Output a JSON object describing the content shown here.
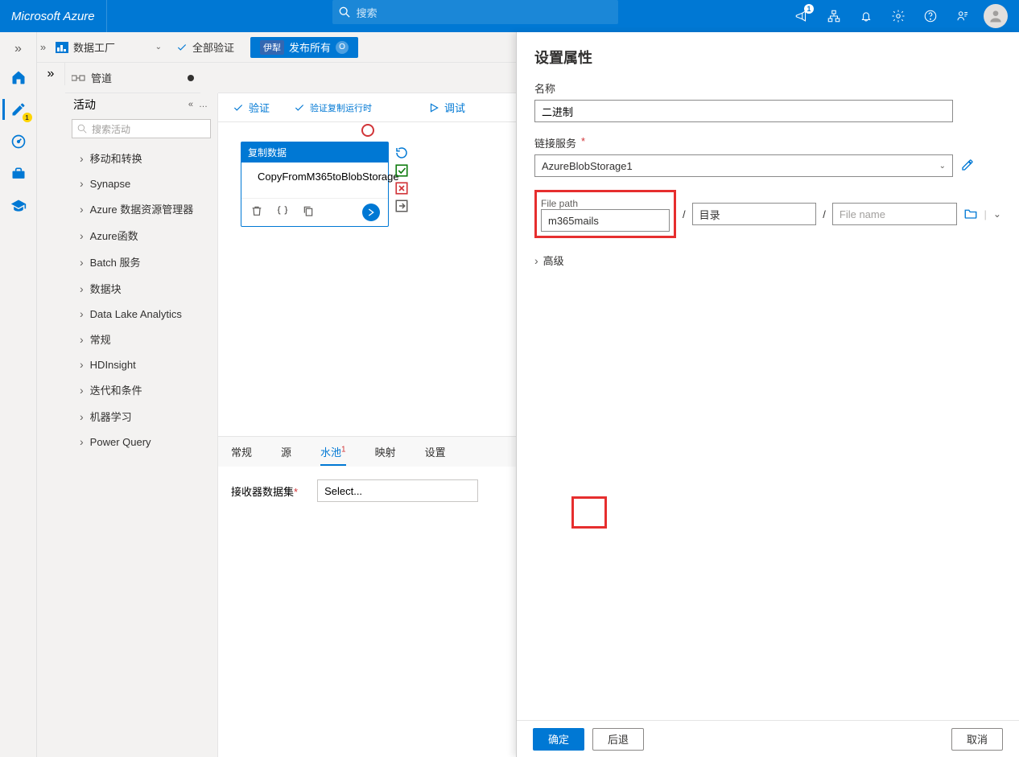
{
  "header": {
    "logo": "Microsoft Azure",
    "search_placeholder": "搜索",
    "megaphone_badge": "1"
  },
  "toolbar": {
    "factory_label": "数据工厂",
    "validate_all": "全部验证",
    "publish_pill": "伊犁",
    "publish_label": "发布所有",
    "publish_count": "O"
  },
  "tab": {
    "label": "管道"
  },
  "activities": {
    "title": "活动",
    "search_placeholder": "搜索活动",
    "cats": [
      "移动和转换",
      "Synapse",
      "Azure 数据资源管理器",
      "Azure函数",
      "Batch 服务",
      "数据块",
      "Data Lake Analytics",
      "常规",
      "HDInsight",
      "迭代和条件",
      "机器学习",
      "Power Query"
    ]
  },
  "canvas_toolbar": {
    "validate": "验证",
    "validate_copy": "验证复制运行时",
    "debug": "调试"
  },
  "node": {
    "header": "复制数据",
    "title": "CopyFromM365toBlobStorage"
  },
  "details": {
    "tabs": [
      "常规",
      "源",
      "水池",
      "映射",
      "设置"
    ],
    "active_idx": 2,
    "sink_badge": "1",
    "sink_label": "接收器数据集",
    "sink_select": "Select..."
  },
  "panel": {
    "title": "设置属性",
    "name_label": "名称",
    "name_value": "二进制",
    "linked_label": "链接服务",
    "linked_value": "AzureBlobStorage1",
    "filepath_label": "File path",
    "fp_container": "m365mails",
    "fp_dir_placeholder": "目录",
    "fp_file_placeholder": "File name",
    "advanced": "高级",
    "ok": "确定",
    "back": "后退",
    "cancel": "取消"
  },
  "sep": "/"
}
